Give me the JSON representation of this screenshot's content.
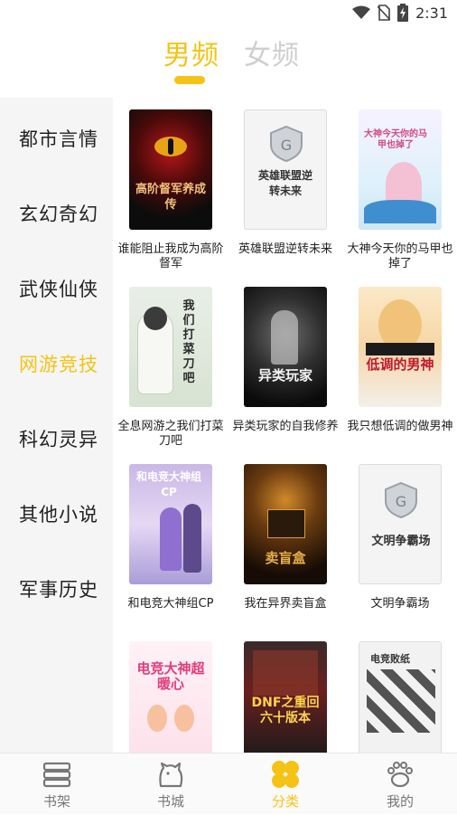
{
  "status_bar": {
    "time": "2:31",
    "icons": [
      "wifi-icon",
      "no-sim-icon",
      "battery-charging-icon"
    ]
  },
  "gender_tabs": [
    {
      "label": "男频",
      "active": true
    },
    {
      "label": "女频",
      "active": false
    }
  ],
  "categories": [
    {
      "label": "都市言情",
      "active": false
    },
    {
      "label": "玄幻奇幻",
      "active": false
    },
    {
      "label": "武侠仙侠",
      "active": false
    },
    {
      "label": "网游竞技",
      "active": true
    },
    {
      "label": "科幻灵异",
      "active": false
    },
    {
      "label": "其他小说",
      "active": false
    },
    {
      "label": "军事历史",
      "active": false
    }
  ],
  "books": [
    {
      "title": "谁能阻止我成为高阶督军",
      "cover_text": "高阶督军养成传"
    },
    {
      "title": "英雄联盟逆转未来",
      "cover_text": "英雄联盟逆转未来"
    },
    {
      "title": "大神今天你的马甲也掉了",
      "cover_text": "大神今天你的马甲也掉了"
    },
    {
      "title": "全息网游之我们打菜刀吧",
      "cover_text": "我们打菜刀吧"
    },
    {
      "title": "异类玩家的自我修养",
      "cover_text": "异类玩家"
    },
    {
      "title": "我只想低调的做男神",
      "cover_text": "低调的男神"
    },
    {
      "title": "和电竞大神组CP",
      "cover_text": "和电竞大神组CP"
    },
    {
      "title": "我在异界卖盲盒",
      "cover_text": "卖盲盒"
    },
    {
      "title": "文明争霸场",
      "cover_text": "文明争霸场"
    },
    {
      "title": "",
      "cover_text": "电竞大神超暖心"
    },
    {
      "title": "",
      "cover_text": "DNF之重回六十版本"
    },
    {
      "title": "",
      "cover_text": "电竞败纸"
    }
  ],
  "bottom_nav": [
    {
      "label": "书架",
      "icon": "bookshelf-icon",
      "active": false
    },
    {
      "label": "书城",
      "icon": "bear-icon",
      "active": false
    },
    {
      "label": "分类",
      "icon": "category-icon",
      "active": true
    },
    {
      "label": "我的",
      "icon": "paw-icon",
      "active": false
    }
  ],
  "colors": {
    "accent": "#f5c315",
    "sidebar_bg": "#f5f5f5",
    "inactive_text": "#cfcfcf"
  }
}
